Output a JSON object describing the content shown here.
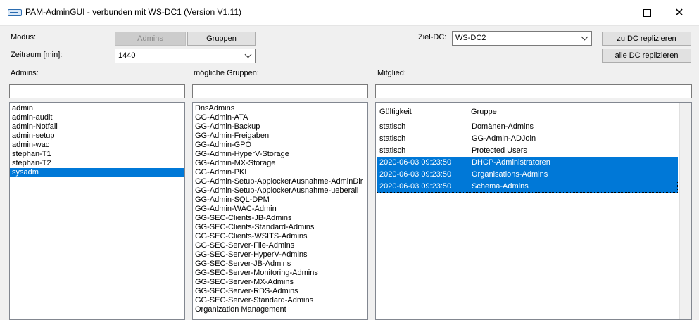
{
  "window": {
    "title": "PAM-AdminGUI - verbunden mit WS-DC1 (Version V1.11)"
  },
  "controls": {
    "modus_label": "Modus:",
    "admins_button": "Admins",
    "gruppen_button": "Gruppen",
    "zeitraum_label": "Zeitraum [min]:",
    "zeitraum_value": "1440",
    "zieldc_label": "Ziel-DC:",
    "zieldc_value": "WS-DC2",
    "replicate_button": "zu DC replizieren",
    "replicate_all_button": "alle DC replizieren"
  },
  "admins": {
    "label": "Admins:",
    "filter_value": "",
    "items": [
      "admin",
      "admin-audit",
      "admin-Notfall",
      "admin-setup",
      "admin-wac",
      "stephan-T1",
      "stephan-T2",
      "sysadm"
    ],
    "selected": "sysadm"
  },
  "groups": {
    "label": "mögliche Gruppen:",
    "filter_value": "",
    "items": [
      "DnsAdmins",
      "GG-Admin-ATA",
      "GG-Admin-Backup",
      "GG-Admin-Freigaben",
      "GG-Admin-GPO",
      "GG-Admin-HyperV-Storage",
      "GG-Admin-MX-Storage",
      "GG-Admin-PKI",
      "GG-Admin-Setup-ApplockerAusnahme-AdminDir",
      "GG-Admin-Setup-ApplockerAusnahme-ueberall",
      "GG-Admin-SQL-DPM",
      "GG-Admin-WAC-Admin",
      "GG-SEC-Clients-JB-Admins",
      "GG-SEC-Clients-Standard-Admins",
      "GG-SEC-Clients-WSITS-Admins",
      "GG-SEC-Server-File-Admins",
      "GG-SEC-Server-HyperV-Admins",
      "GG-SEC-Server-JB-Admins",
      "GG-SEC-Server-Monitoring-Admins",
      "GG-SEC-Server-MX-Admins",
      "GG-SEC-Server-RDS-Admins",
      "GG-SEC-Server-Standard-Admins",
      "Organization Management"
    ]
  },
  "member": {
    "label": "Mitglied:",
    "filter_value": "",
    "columns": [
      "Gültigkeit",
      "Gruppe"
    ],
    "rows": [
      {
        "validity": "statisch",
        "group": "Domänen-Admins",
        "selected": false
      },
      {
        "validity": "statisch",
        "group": "GG-Admin-ADJoin",
        "selected": false
      },
      {
        "validity": "statisch",
        "group": "Protected Users",
        "selected": false
      },
      {
        "validity": "2020-06-03 09:23:50",
        "group": "DHCP-Administratoren",
        "selected": true
      },
      {
        "validity": "2020-06-03 09:23:50",
        "group": "Organisations-Admins",
        "selected": true
      },
      {
        "validity": "2020-06-03 09:23:50",
        "group": "Schema-Admins",
        "selected": true
      }
    ]
  },
  "colors": {
    "selection": "#0078d7",
    "window_bg": "#f0f0f0"
  }
}
